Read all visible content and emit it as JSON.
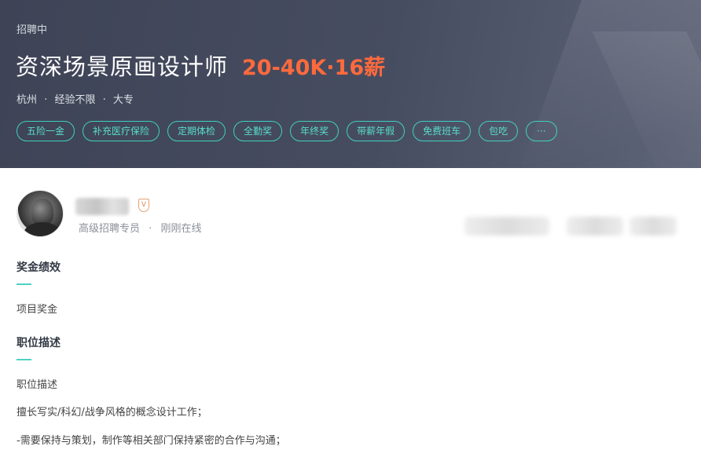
{
  "banner": {
    "status": "招聘中",
    "job_title": "资深场景原画设计师",
    "salary": "20-40K·16薪",
    "meta": {
      "city": "杭州",
      "experience": "经验不限",
      "education": "大专",
      "separator": "·"
    }
  },
  "tags": [
    "五险一金",
    "补充医疗保险",
    "定期体检",
    "全勤奖",
    "年终奖",
    "带薪年假",
    "免费班车",
    "包吃",
    "···"
  ],
  "recruiter": {
    "badge": "V",
    "role": "高级招聘专员",
    "separator": "·",
    "online_status": "刚刚在线"
  },
  "sections": {
    "bonus": {
      "heading": "奖金绩效",
      "text": "项目奖金"
    },
    "description": {
      "heading": "职位描述",
      "lines": [
        "职位描述",
        "擅长写实/科幻/战争风格的概念设计工作；",
        "-需要保持与策划，制作等相关部门保持紧密的合作与沟通；"
      ]
    }
  },
  "colors": {
    "accent_teal": "#4fd2c2",
    "salary_orange": "#ff6a3d",
    "banner_bg": "#474d61"
  }
}
